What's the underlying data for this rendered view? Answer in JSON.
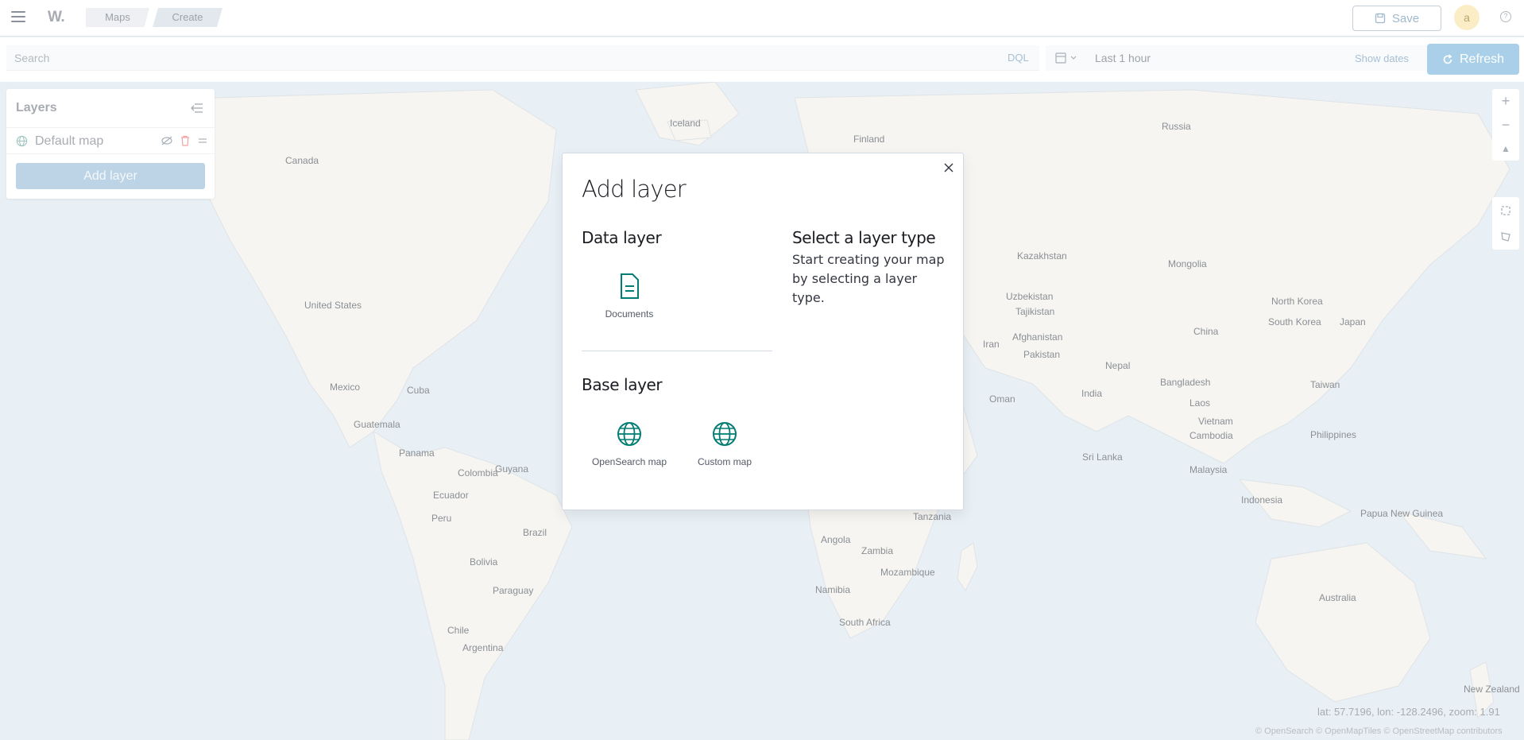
{
  "header": {
    "menu_icon": "hamburger-icon",
    "logo": "W.",
    "breadcrumbs": [
      "Maps",
      "Create"
    ],
    "save_label": "Save",
    "avatar_letter": "a",
    "help_icon": "help-icon"
  },
  "query_bar": {
    "search_placeholder": "Search",
    "language": "DQL",
    "time_range": "Last 1 hour",
    "show_dates": "Show dates",
    "refresh_label": "Refresh"
  },
  "layers_panel": {
    "title": "Layers",
    "items": [
      {
        "name": "Default map"
      }
    ],
    "add_layer_label": "Add layer"
  },
  "map": {
    "countries": [
      "Iceland",
      "Finland",
      "Russia",
      "Canada",
      "Kazakhstan",
      "Mongolia",
      "Uzbekistan",
      "Tajikistan",
      "North Korea",
      "United States",
      "South Korea",
      "Japan",
      "Afghanistan",
      "China",
      "Iran",
      "Pakistan",
      "Nepal",
      "Mexico",
      "Cuba",
      "Bangladesh",
      "India",
      "Oman",
      "Taiwan",
      "Laos",
      "Guatemala",
      "Vietnam",
      "Philippines",
      "Cambodia",
      "Panama",
      "Guyana",
      "Sri Lanka",
      "Colombia",
      "Malaysia",
      "Ecuador",
      "Indonesia",
      "Papua New Guinea",
      "Peru",
      "Brazil",
      "Tanzania",
      "Angola",
      "Zambia",
      "Bolivia",
      "Mozambique",
      "Paraguay",
      "Namibia",
      "Australia",
      "South Africa",
      "Chile",
      "Argentina",
      "New Zealand"
    ],
    "coordinates": "lat: 57.7196, lon: -128.2496, zoom: 1.91",
    "attribution": "© OpenSearch © OpenMapTiles © OpenStreetMap contributors"
  },
  "modal": {
    "title": "Add layer",
    "data_layer_title": "Data layer",
    "data_layer_items": [
      {
        "label": "Documents",
        "icon": "document-icon"
      }
    ],
    "base_layer_title": "Base layer",
    "base_layer_items": [
      {
        "label": "OpenSearch map",
        "icon": "globe-icon"
      },
      {
        "label": "Custom map",
        "icon": "globe-icon"
      }
    ],
    "help_title": "Select a layer type",
    "help_text": "Start creating your map by selecting a layer type."
  },
  "colors": {
    "accent": "#017d73",
    "primary_button": "#a9d0e8",
    "map_water": "#e8f0f6",
    "map_land": "#f6f5f1"
  }
}
